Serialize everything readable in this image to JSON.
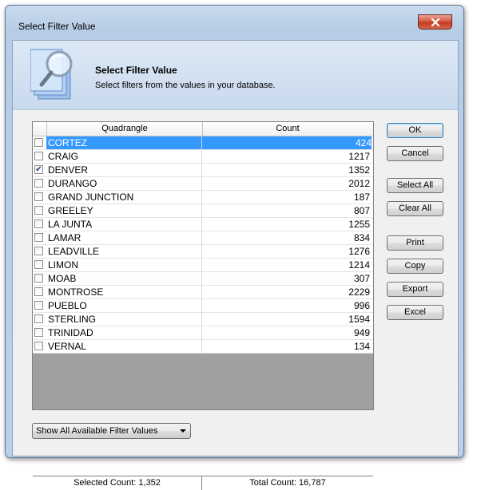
{
  "window": {
    "title": "Select Filter Value"
  },
  "header": {
    "title": "Select Filter Value",
    "subtitle": "Select filters from the values in your database."
  },
  "grid": {
    "columns": [
      "Quadrangle",
      "Count"
    ],
    "rows": [
      {
        "name": "CORTEZ",
        "count": "424",
        "checked": false,
        "selected": true
      },
      {
        "name": "CRAIG",
        "count": "1217",
        "checked": false
      },
      {
        "name": "DENVER",
        "count": "1352",
        "checked": true
      },
      {
        "name": "DURANGO",
        "count": "2012",
        "checked": false
      },
      {
        "name": "GRAND JUNCTION",
        "count": "187",
        "checked": false
      },
      {
        "name": "GREELEY",
        "count": "807",
        "checked": false
      },
      {
        "name": "LA JUNTA",
        "count": "1255",
        "checked": false
      },
      {
        "name": "LAMAR",
        "count": "834",
        "checked": false
      },
      {
        "name": "LEADVILLE",
        "count": "1276",
        "checked": false
      },
      {
        "name": "LIMON",
        "count": "1214",
        "checked": false
      },
      {
        "name": "MOAB",
        "count": "307",
        "checked": false
      },
      {
        "name": "MONTROSE",
        "count": "2229",
        "checked": false
      },
      {
        "name": "PUEBLO",
        "count": "996",
        "checked": false
      },
      {
        "name": "STERLING",
        "count": "1594",
        "checked": false
      },
      {
        "name": "TRINIDAD",
        "count": "949",
        "checked": false
      },
      {
        "name": "VERNAL",
        "count": "134",
        "checked": false
      }
    ],
    "selected_count": "Selected Count: 1,352",
    "total_count": "Total Count: 16,787"
  },
  "buttons": {
    "ok": "OK",
    "cancel": "Cancel",
    "select_all": "Select All",
    "clear_all": "Clear All",
    "print": "Print",
    "copy": "Copy",
    "export": "Export",
    "excel": "Excel"
  },
  "filter_mode": {
    "selected": "Show All Available Filter Values"
  },
  "colors": {
    "selection": "#3399ff",
    "close_button": "#c0381e"
  }
}
